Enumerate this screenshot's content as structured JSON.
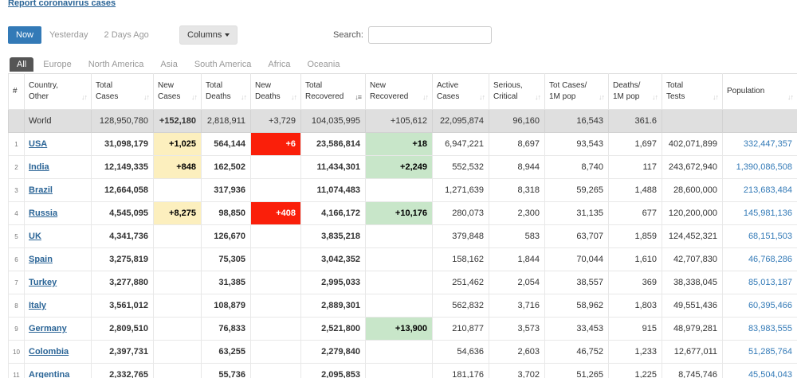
{
  "report_link": "Report coronavirus cases",
  "filters": {
    "days": [
      "Now",
      "Yesterday",
      "2 Days Ago"
    ],
    "active_day": 0,
    "columns_label": "Columns",
    "search_label": "Search:",
    "search_value": ""
  },
  "continent_tabs": [
    "All",
    "Europe",
    "North America",
    "Asia",
    "South America",
    "Africa",
    "Oceania"
  ],
  "active_tab": 0,
  "table": {
    "headers": [
      {
        "key": "idx",
        "label": "#"
      },
      {
        "key": "country",
        "label": "Country,\nOther"
      },
      {
        "key": "total_cases",
        "label": "Total\nCases"
      },
      {
        "key": "new_cases",
        "label": "New\nCases"
      },
      {
        "key": "total_deaths",
        "label": "Total\nDeaths"
      },
      {
        "key": "new_deaths",
        "label": "New\nDeaths"
      },
      {
        "key": "total_recovered",
        "label": "Total\nRecovered",
        "sorted": true
      },
      {
        "key": "new_recovered",
        "label": "New\nRecovered"
      },
      {
        "key": "active_cases",
        "label": "Active\nCases"
      },
      {
        "key": "serious",
        "label": "Serious,\nCritical"
      },
      {
        "key": "tot_cases_1m",
        "label": "Tot Cases/\n1M pop"
      },
      {
        "key": "deaths_1m",
        "label": "Deaths/\n1M pop"
      },
      {
        "key": "total_tests",
        "label": "Total\nTests"
      },
      {
        "key": "population",
        "label": "Population"
      }
    ],
    "world": {
      "idx": "",
      "country": "World",
      "total_cases": "128,950,780",
      "new_cases": "+152,180",
      "total_deaths": "2,818,911",
      "new_deaths": "+3,729",
      "total_recovered": "104,035,995",
      "new_recovered": "+105,612",
      "active_cases": "22,095,874",
      "serious": "96,160",
      "tot_cases_1m": "16,543",
      "deaths_1m": "361.6",
      "total_tests": "",
      "population": ""
    },
    "rows": [
      {
        "idx": "1",
        "country": "USA",
        "total_cases": "31,098,179",
        "new_cases": "+1,025",
        "total_deaths": "564,144",
        "new_deaths": "+6",
        "total_recovered": "23,586,814",
        "new_recovered": "+18",
        "active_cases": "6,947,221",
        "serious": "8,697",
        "tot_cases_1m": "93,543",
        "deaths_1m": "1,697",
        "total_tests": "402,071,899",
        "population": "332,447,357"
      },
      {
        "idx": "2",
        "country": "India",
        "total_cases": "12,149,335",
        "new_cases": "+848",
        "total_deaths": "162,502",
        "new_deaths": "",
        "total_recovered": "11,434,301",
        "new_recovered": "+2,249",
        "active_cases": "552,532",
        "serious": "8,944",
        "tot_cases_1m": "8,740",
        "deaths_1m": "117",
        "total_tests": "243,672,940",
        "population": "1,390,086,508"
      },
      {
        "idx": "3",
        "country": "Brazil",
        "total_cases": "12,664,058",
        "new_cases": "",
        "total_deaths": "317,936",
        "new_deaths": "",
        "total_recovered": "11,074,483",
        "new_recovered": "",
        "active_cases": "1,271,639",
        "serious": "8,318",
        "tot_cases_1m": "59,265",
        "deaths_1m": "1,488",
        "total_tests": "28,600,000",
        "population": "213,683,484"
      },
      {
        "idx": "4",
        "country": "Russia",
        "total_cases": "4,545,095",
        "new_cases": "+8,275",
        "total_deaths": "98,850",
        "new_deaths": "+408",
        "total_recovered": "4,166,172",
        "new_recovered": "+10,176",
        "active_cases": "280,073",
        "serious": "2,300",
        "tot_cases_1m": "31,135",
        "deaths_1m": "677",
        "total_tests": "120,200,000",
        "population": "145,981,136"
      },
      {
        "idx": "5",
        "country": "UK",
        "total_cases": "4,341,736",
        "new_cases": "",
        "total_deaths": "126,670",
        "new_deaths": "",
        "total_recovered": "3,835,218",
        "new_recovered": "",
        "active_cases": "379,848",
        "serious": "583",
        "tot_cases_1m": "63,707",
        "deaths_1m": "1,859",
        "total_tests": "124,452,321",
        "population": "68,151,503"
      },
      {
        "idx": "6",
        "country": "Spain",
        "total_cases": "3,275,819",
        "new_cases": "",
        "total_deaths": "75,305",
        "new_deaths": "",
        "total_recovered": "3,042,352",
        "new_recovered": "",
        "active_cases": "158,162",
        "serious": "1,844",
        "tot_cases_1m": "70,044",
        "deaths_1m": "1,610",
        "total_tests": "42,707,830",
        "population": "46,768,286"
      },
      {
        "idx": "7",
        "country": "Turkey",
        "total_cases": "3,277,880",
        "new_cases": "",
        "total_deaths": "31,385",
        "new_deaths": "",
        "total_recovered": "2,995,033",
        "new_recovered": "",
        "active_cases": "251,462",
        "serious": "2,054",
        "tot_cases_1m": "38,557",
        "deaths_1m": "369",
        "total_tests": "38,338,045",
        "population": "85,013,187"
      },
      {
        "idx": "8",
        "country": "Italy",
        "total_cases": "3,561,012",
        "new_cases": "",
        "total_deaths": "108,879",
        "new_deaths": "",
        "total_recovered": "2,889,301",
        "new_recovered": "",
        "active_cases": "562,832",
        "serious": "3,716",
        "tot_cases_1m": "58,962",
        "deaths_1m": "1,803",
        "total_tests": "49,551,436",
        "population": "60,395,466"
      },
      {
        "idx": "9",
        "country": "Germany",
        "total_cases": "2,809,510",
        "new_cases": "",
        "total_deaths": "76,833",
        "new_deaths": "",
        "total_recovered": "2,521,800",
        "new_recovered": "+13,900",
        "active_cases": "210,877",
        "serious": "3,573",
        "tot_cases_1m": "33,453",
        "deaths_1m": "915",
        "total_tests": "48,979,281",
        "population": "83,983,555"
      },
      {
        "idx": "10",
        "country": "Colombia",
        "total_cases": "2,397,731",
        "new_cases": "",
        "total_deaths": "63,255",
        "new_deaths": "",
        "total_recovered": "2,279,840",
        "new_recovered": "",
        "active_cases": "54,636",
        "serious": "2,603",
        "tot_cases_1m": "46,752",
        "deaths_1m": "1,233",
        "total_tests": "12,677,011",
        "population": "51,285,764"
      },
      {
        "idx": "11",
        "country": "Argentina",
        "total_cases": "2,332,765",
        "new_cases": "",
        "total_deaths": "55,736",
        "new_deaths": "",
        "total_recovered": "2,095,853",
        "new_recovered": "",
        "active_cases": "181,176",
        "serious": "3,702",
        "tot_cases_1m": "51,265",
        "deaths_1m": "1,225",
        "total_tests": "8,745,746",
        "population": "45,504,043"
      }
    ]
  }
}
